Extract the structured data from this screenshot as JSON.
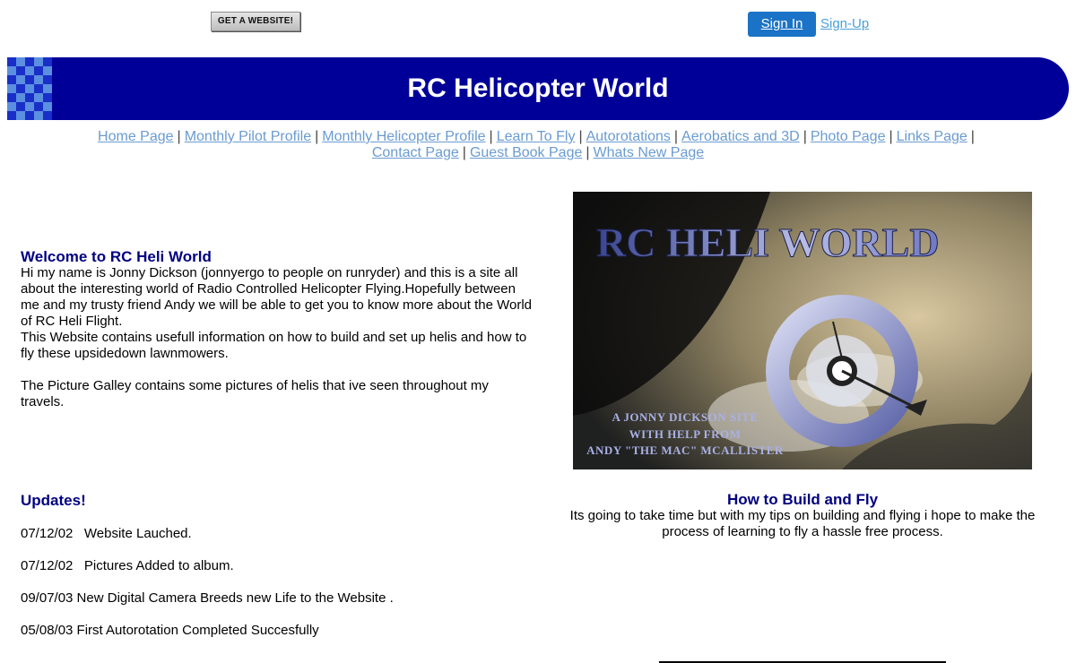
{
  "top": {
    "get_website": "GET A WEBSITE!",
    "sign_in": "Sign In",
    "sign_up": "Sign-Up"
  },
  "banner": {
    "title": "RC Helicopter World"
  },
  "nav": {
    "row1": [
      "Home Page",
      "Monthly Pilot Profile",
      "Monthly Helicopter Profile",
      "Learn To Fly",
      "Autorotations",
      "Aerobatics and 3D",
      "Photo Page",
      "Links Page"
    ],
    "row2": [
      "Contact Page",
      "Guest Book Page",
      "Whats New Page"
    ],
    "separator": "|"
  },
  "welcome": {
    "heading": "Welcome to RC Heli World",
    "p1": "Hi my name is Jonny Dickson (jonnyergo to people on runryder) and this is a site all about the interesting world of Radio Controlled Helicopter Flying.Hopefully between me and my trusty friend Andy we will be able to get you to know more about the World of RC Heli Flight.",
    "p2": "This Website contains usefull information on how to build and set up helis and how to fly these upsidedown lawnmowers.",
    "p3": "The Picture Galley contains some pictures of helis that ive seen throughout my travels."
  },
  "hero": {
    "title": "RC HELI WORLD",
    "caption1": "A JONNY DICKSON SITE",
    "caption2": "WITH HELP FROM",
    "caption3": "ANDY \"THE MAC\" MCALLISTER"
  },
  "updates": {
    "heading": "Updates!",
    "items": [
      "07/12/02   Website Lauched.",
      "07/12/02   Pictures Added to album.",
      "09/07/03 New Digital Camera Breeds new Life to the Website .",
      "05/08/03 First Autorotation Completed Succesfully"
    ]
  },
  "howto": {
    "heading": "How to Build and Fly",
    "text": "Its going to take time but with my tips on building and flying i hope to make the process of learning to fly a hassle free process."
  }
}
